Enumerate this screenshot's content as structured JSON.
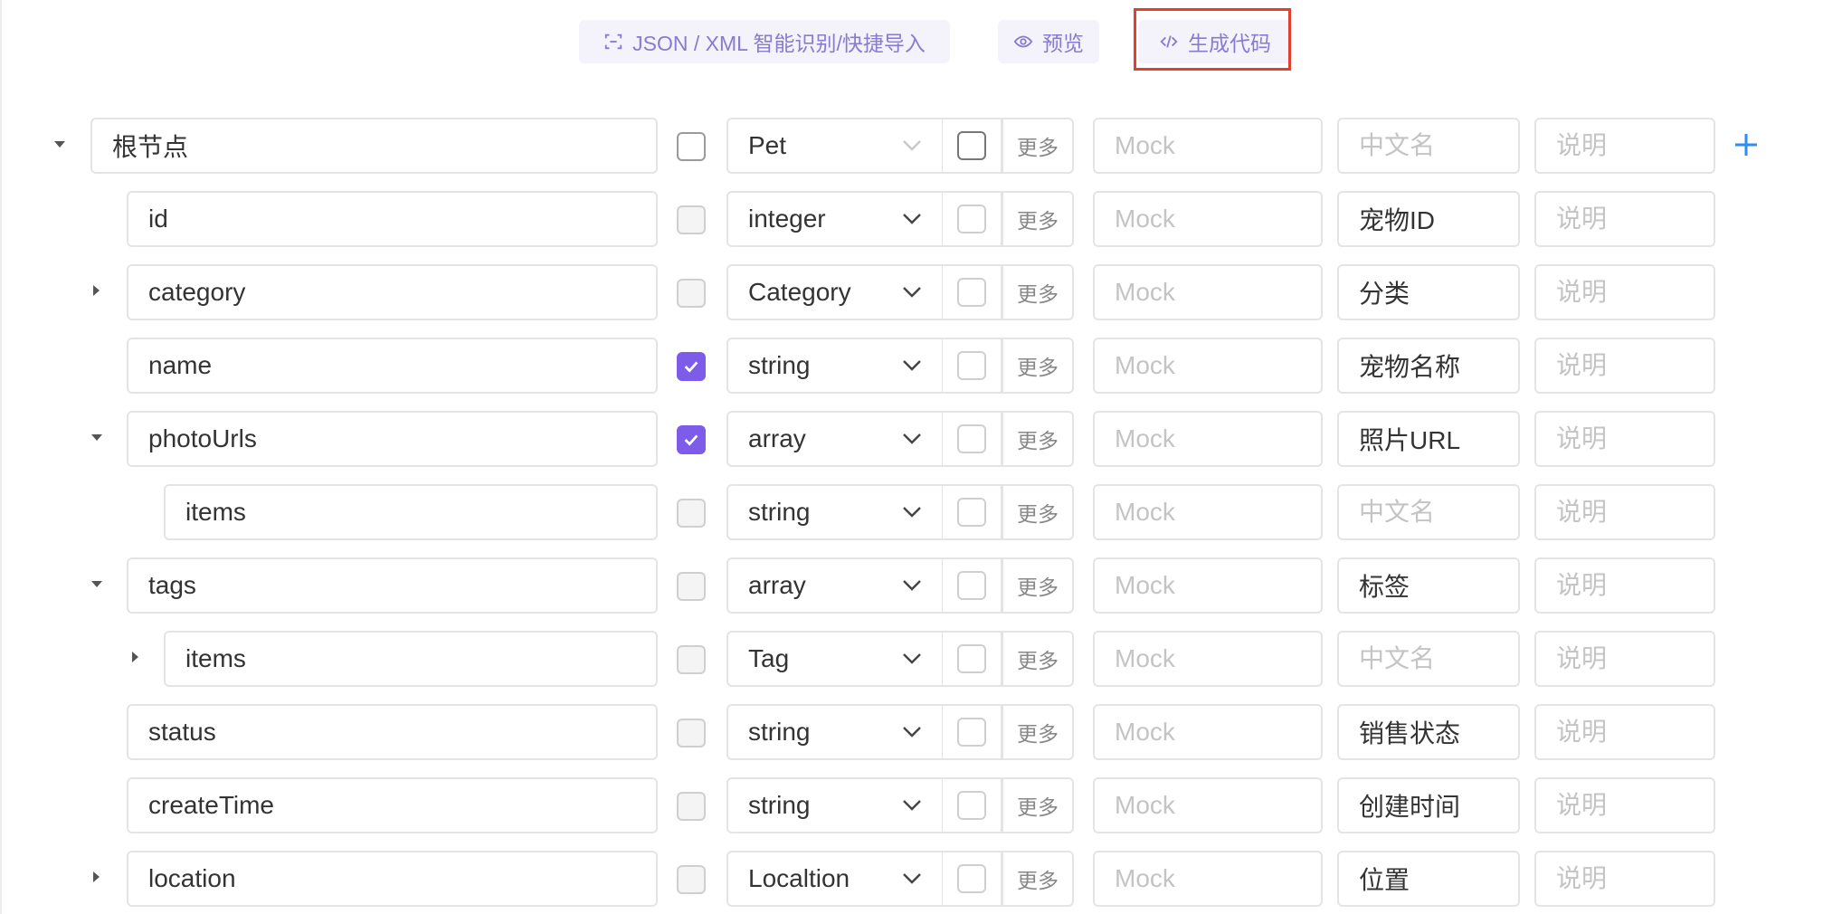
{
  "toolbar": {
    "import_label": "JSON / XML 智能识别/快捷导入",
    "preview_label": "预览",
    "codegen_label": "生成代码"
  },
  "accent_color": "#7c5ce8",
  "highlight_color": "#e0412e",
  "placeholders": {
    "mock": "Mock",
    "cn_name": "中文名",
    "desc": "说明"
  },
  "more_label": "更多",
  "rows": [
    {
      "name": "根节点",
      "type": "Pet",
      "required": false,
      "cn_name": "",
      "toggle": "down"
    },
    {
      "name": "id",
      "type": "integer",
      "required": false,
      "cn_name": "宠物ID",
      "toggle": "none"
    },
    {
      "name": "category",
      "type": "Category",
      "required": false,
      "cn_name": "分类",
      "toggle": "right"
    },
    {
      "name": "name",
      "type": "string",
      "required": true,
      "cn_name": "宠物名称",
      "toggle": "none"
    },
    {
      "name": "photoUrls",
      "type": "array",
      "required": true,
      "cn_name": "照片URL",
      "toggle": "down"
    },
    {
      "name": "items",
      "type": "string",
      "required": false,
      "cn_name": "",
      "toggle": "none"
    },
    {
      "name": "tags",
      "type": "array",
      "required": false,
      "cn_name": "标签",
      "toggle": "down"
    },
    {
      "name": "items",
      "type": "Tag",
      "required": false,
      "cn_name": "",
      "toggle": "right"
    },
    {
      "name": "status",
      "type": "string",
      "required": false,
      "cn_name": "销售状态",
      "toggle": "none"
    },
    {
      "name": "createTime",
      "type": "string",
      "required": false,
      "cn_name": "创建时间",
      "toggle": "none"
    },
    {
      "name": "location",
      "type": "Localtion",
      "required": false,
      "cn_name": "位置",
      "toggle": "right"
    }
  ]
}
